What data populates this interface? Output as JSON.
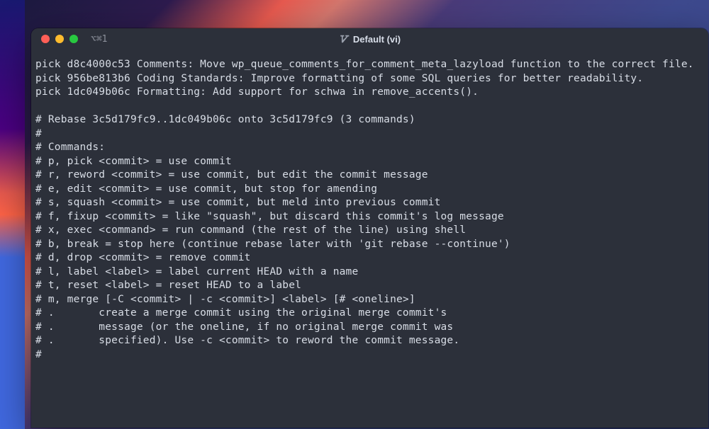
{
  "window": {
    "tab_indicator": "⌥⌘1",
    "title": "Default (vi)"
  },
  "terminal": {
    "lines": [
      "pick d8c4000c53 Comments: Move wp_queue_comments_for_comment_meta_lazyload function to the correct file.",
      "pick 956be813b6 Coding Standards: Improve formatting of some SQL queries for better readability.",
      "pick 1dc049b06c Formatting: Add support for schwa in remove_accents().",
      "",
      "# Rebase 3c5d179fc9..1dc049b06c onto 3c5d179fc9 (3 commands)",
      "#",
      "# Commands:",
      "# p, pick <commit> = use commit",
      "# r, reword <commit> = use commit, but edit the commit message",
      "# e, edit <commit> = use commit, but stop for amending",
      "# s, squash <commit> = use commit, but meld into previous commit",
      "# f, fixup <commit> = like \"squash\", but discard this commit's log message",
      "# x, exec <command> = run command (the rest of the line) using shell",
      "# b, break = stop here (continue rebase later with 'git rebase --continue')",
      "# d, drop <commit> = remove commit",
      "# l, label <label> = label current HEAD with a name",
      "# t, reset <label> = reset HEAD to a label",
      "# m, merge [-C <commit> | -c <commit>] <label> [# <oneline>]",
      "# .       create a merge commit using the original merge commit's",
      "# .       message (or the oneline, if no original merge commit was",
      "# .       specified). Use -c <commit> to reword the commit message.",
      "#"
    ]
  }
}
